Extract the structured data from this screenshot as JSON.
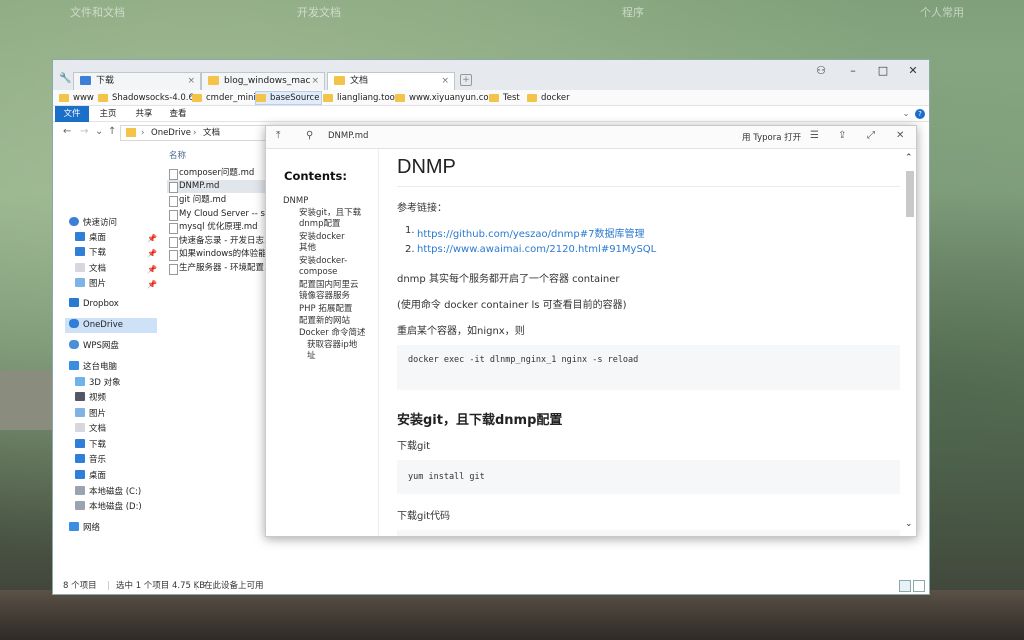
{
  "desktop": {
    "labels": [
      "文件和文档",
      "开发文档",
      "程序",
      "个人常用"
    ]
  },
  "browser": {
    "tabs": [
      {
        "label": "下载"
      },
      {
        "label": "blog_windows_mac"
      },
      {
        "label": "文档"
      }
    ],
    "bookmarks": [
      "www",
      "Shadowsocks-4.0.6",
      "cmder_mini",
      "baseSource",
      "liangliang.too",
      "www.xiyuanyun.com",
      "Test",
      "docker"
    ]
  },
  "explorer": {
    "ribbon": [
      "文件",
      "主页",
      "共享",
      "查看"
    ],
    "breadcrumb": [
      "OneDrive",
      "文档"
    ],
    "nav": [
      "快速访问",
      "桌面",
      "下载",
      "文档",
      "图片",
      "Dropbox",
      "OneDrive",
      "WPS网盘",
      "这台电脑",
      "3D 对象",
      "视频",
      "图片",
      "文档",
      "下载",
      "音乐",
      "桌面",
      "本地磁盘 (C:)",
      "本地磁盘 (D:)",
      "网络"
    ],
    "column_name": "名称",
    "files": [
      "composer问题.md",
      "DNMP.md",
      "git 问题.md",
      "My  Cloud Server -- se",
      "mysql 优化原理.md",
      "快速备忘录 - 开发日志.n",
      "如果windows的体验能和",
      "生产服务器 - 环境配置.n"
    ],
    "status": {
      "count": "8 个项目",
      "selected": "选中 1 个项目  4.75 KB",
      "availability": "在此设备上可用"
    }
  },
  "preview": {
    "filename": "DNMP.md",
    "open_with": "用 Typora 打开",
    "toc_title": "Contents:",
    "toc": [
      "DNMP",
      "安装git，且下载dnmp配置",
      "安装docker 其他",
      "安装docker-compose",
      "配置国内阿里云镜像容器服务",
      "PHP 拓展配置",
      "配置新的网站",
      "Docker 命令简述",
      "获取容器ip地址"
    ],
    "h1": "DNMP",
    "ref_label": "参考链接：",
    "links": [
      "https://github.com/yeszao/dnmp#7数据库管理",
      "https://www.awaimai.com/2120.html#91MySQL"
    ],
    "p1": "dnmp 其实每个服务都开启了一个容器 container",
    "p2": "(使用命令 docker container ls 可查看目前的容器)",
    "p3": "重启某个容器，如nignx，则",
    "code1": "docker exec -it dlnmp_nginx_1 nginx -s reload",
    "h2": "安装git，且下载dnmp配置",
    "p4": "下载git",
    "code2": "yum install git",
    "p5": "下载git代码"
  }
}
